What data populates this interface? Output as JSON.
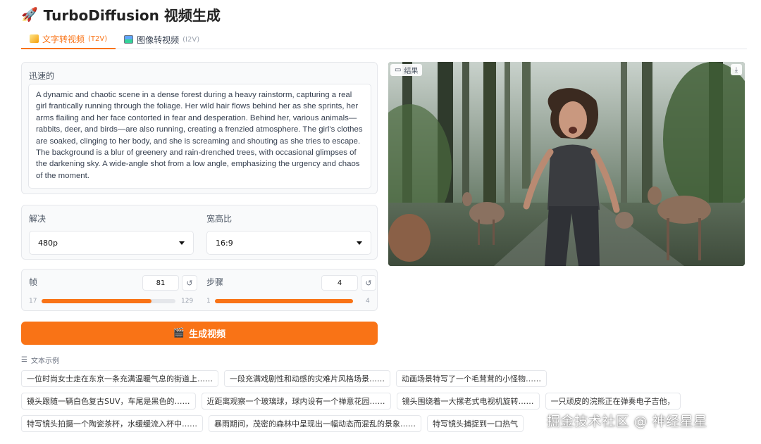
{
  "app": {
    "title": "TurboDiffusion 视频生成"
  },
  "tabs": [
    {
      "label": "文字转视频",
      "sub": "(T2V)",
      "active": true,
      "icon": "pencil-icon"
    },
    {
      "label": "图像转视频",
      "sub": "(I2V)",
      "active": false,
      "icon": "picture-icon"
    }
  ],
  "prompt": {
    "label": "迅速的",
    "value": "A dynamic and chaotic scene in a dense forest during a heavy rainstorm, capturing a real girl frantically running through the foliage. Her wild hair flows behind her as she sprints, her arms flailing and her face contorted in fear and desperation. Behind her, various animals—rabbits, deer, and birds—are also running, creating a frenzied atmosphere. The girl's clothes are soaked, clinging to her body, and she is screaming and shouting as she tries to escape. The background is a blur of greenery and rain-drenched trees, with occasional glimpses of the darkening sky. A wide-angle shot from a low angle, emphasizing the urgency and chaos of the moment."
  },
  "resolution": {
    "label": "解决",
    "value": "480p"
  },
  "aspect": {
    "label": "宽高比",
    "value": "16:9"
  },
  "frames": {
    "label": "帧",
    "value": "81",
    "min": "17",
    "max": "129",
    "fill_percent": 82
  },
  "steps": {
    "label": "步骤",
    "value": "4",
    "min": "1",
    "max": "4",
    "fill_percent": 100
  },
  "generate": {
    "label": "生成视频",
    "icon": "clapper-icon"
  },
  "result": {
    "label": "结果",
    "icon": "video-icon",
    "download_icon": "download-icon"
  },
  "examples": {
    "title": "文本示例",
    "rows": [
      [
        "一位时尚女士走在东京一条充满温暖气息的街道上……",
        "一段充满戏剧性和动感的灾难片风格场景……",
        "动画场景特写了一个毛茸茸的小怪物……"
      ],
      [
        "镜头跟随一辆白色复古SUV，车尾是黑色的……",
        "近距离观察一个玻璃球，球内设有一个禅意花园……",
        "镜头围绕着一大摞老式电视机旋转……",
        "一只顽皮的浣熊正在弹奏电子吉他，"
      ],
      [
        "特写镜头拍摄一个陶瓷茶杯，水缓缓流入杯中……",
        "暴雨期间，茂密的森林中呈现出一幅动态而混乱的景象……",
        "特写镜头捕捉到一口热气"
      ]
    ]
  },
  "watermark": "掘金技术社区 @ 神经星星",
  "colors": {
    "accent": "#f97316"
  }
}
